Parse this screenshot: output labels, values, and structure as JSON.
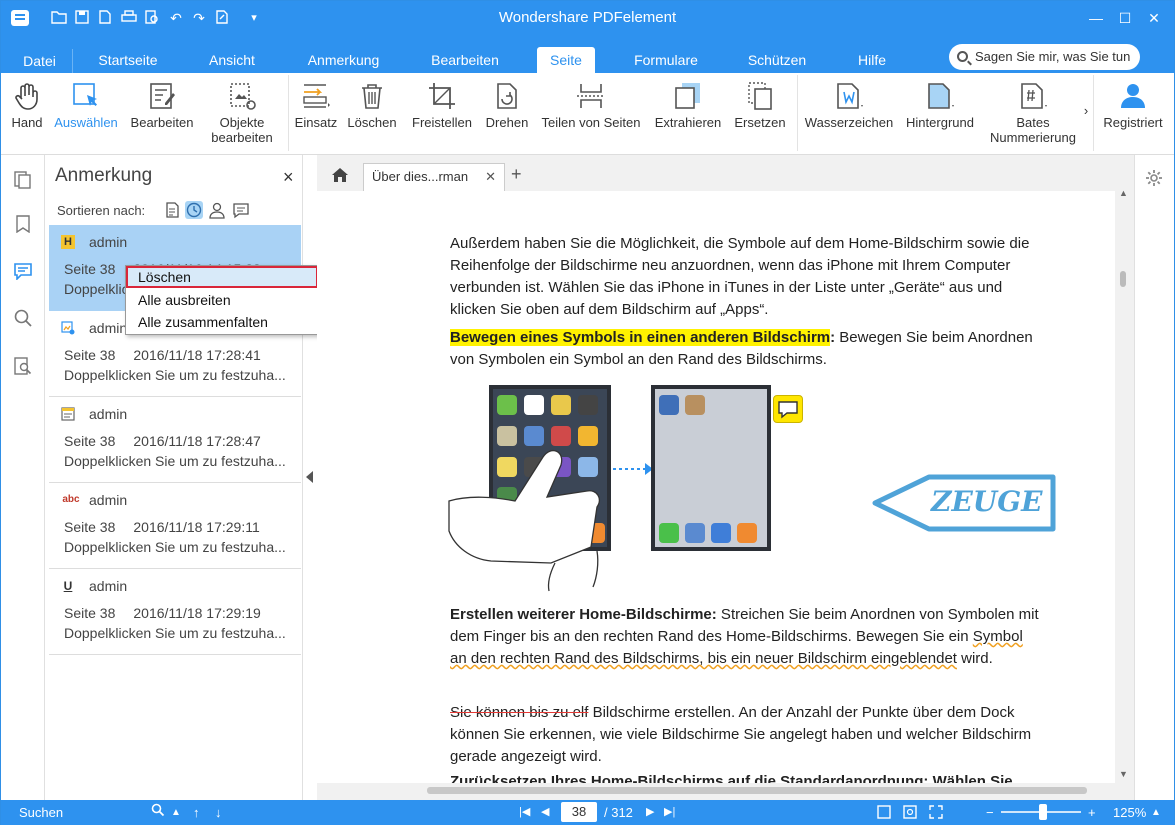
{
  "app": {
    "title": "Wondershare PDFelement"
  },
  "menu": {
    "file": "Datei",
    "tabs": [
      "Startseite",
      "Ansicht",
      "Anmerkung",
      "Bearbeiten",
      "Seite",
      "Formulare",
      "Schützen",
      "Hilfe"
    ],
    "active_tab": "Seite",
    "search_placeholder": "Sagen Sie mir, was Sie tun"
  },
  "ribbon": {
    "hand": "Hand",
    "select": "Auswählen",
    "edit": "Bearbeiten",
    "objects_1": "Objekte",
    "objects_2": "bearbeiten",
    "insert": "Einsatz",
    "delete": "Löschen",
    "crop": "Freistellen",
    "rotate": "Drehen",
    "split": "Teilen von Seiten",
    "extract": "Extrahieren",
    "replace": "Ersetzen",
    "watermark": "Wasserzeichen",
    "background": "Hintergrund",
    "bates_1": "Bates",
    "bates_2": "Nummerierung",
    "registered": "Registriert"
  },
  "panel": {
    "title": "Anmerkung",
    "sort_label": "Sortieren nach:",
    "annotations": [
      {
        "icon": "H",
        "author": "admin",
        "page": "Seite 38",
        "date": "2016/11/16 14:15:28",
        "desc": "Doppelklicken Sie um zu festzuha..."
      },
      {
        "icon": "stamp",
        "author": "admin",
        "page": "Seite 38",
        "date": "2016/11/18 17:28:41",
        "desc": "Doppelklicken Sie um zu festzuha..."
      },
      {
        "icon": "note",
        "author": "admin",
        "page": "Seite 38",
        "date": "2016/11/18 17:28:47",
        "desc": "Doppelklicken Sie um zu festzuha..."
      },
      {
        "icon": "abc",
        "author": "admin",
        "page": "Seite 38",
        "date": "2016/11/18 17:29:11",
        "desc": "Doppelklicken Sie um zu festzuha..."
      },
      {
        "icon": "U",
        "author": "admin",
        "page": "Seite 38",
        "date": "2016/11/18 17:29:19",
        "desc": "Doppelklicken Sie um zu festzuha..."
      }
    ]
  },
  "context_menu": {
    "items": [
      "Löschen",
      "Alle ausbreiten",
      "Alle zusammenfalten"
    ]
  },
  "document": {
    "tab_name": "Über dies...rman",
    "para1": "Außerdem haben Sie die Möglichkeit, die Symbole auf dem Home-Bildschirm sowie die Reihenfolge der Bildschirme neu anzuordnen, wenn das iPhone mit Ihrem Computer verbunden ist. Wählen Sie das iPhone in iTunes in der Liste unter „Geräte“ aus und klicken Sie oben auf dem Bildschirm auf „Apps“.",
    "para2_head": "Bewegen eines Symbols in einen anderen Bildschirm",
    "para2_colon": ":",
    "para2_body": " Bewegen Sie beim Anordnen von Symbolen ein Symbol an den Rand des Bildschirms.",
    "stamp_text": "ZEUGE",
    "para3_head": "Erstellen weiterer Home-Bildschirme:",
    "para3_body": " Streichen Sie beim Anordnen von Symbolen mit dem Finger bis an den rechten Rand des Home-Bildschirms. Bewegen Sie ein",
    "para3_squiggle": "Symbol an den rechten Rand des Bildschirms, bis ein neuer Bildschirm eingeblendet",
    "para3_end": "wird.",
    "para4_strike": "Sie können bis zu elf",
    "para4_body": " Bildschirme erstellen. An der Anzahl der Punkte über dem Dock können Sie erkennen, wie viele Bildschirme Sie angelegt haben und welcher Bildschirm gerade angezeigt wird.",
    "para5_partial": "Zurücksetzen Ihres Home-Bildschirms auf die Standardanordnung:  Wählen Sie"
  },
  "status": {
    "search": "Suchen",
    "current_page": "38",
    "total_pages": "/ 312",
    "zoom": "125%"
  },
  "colors": {
    "accent": "#2e92ef",
    "highlight": "#fff200",
    "stamp": "#4fa3d8"
  }
}
